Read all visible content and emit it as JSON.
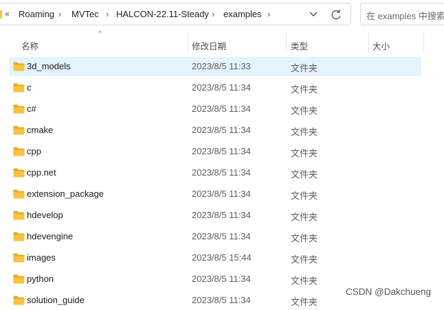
{
  "address_bar": {
    "overflow_label": "«",
    "crumbs": [
      "Roaming",
      "MVTec",
      "HALCON-22.11-Steady",
      "examples"
    ],
    "separator": "›"
  },
  "search": {
    "placeholder": "在 examples 中搜索"
  },
  "columns": {
    "name": "名称",
    "modified": "修改日期",
    "type": "类型",
    "size": "大小"
  },
  "files": [
    {
      "name": "3d_models",
      "modified": "2023/8/5 11:33",
      "type": "文件夹",
      "selected": true
    },
    {
      "name": "c",
      "modified": "2023/8/5 11:34",
      "type": "文件夹"
    },
    {
      "name": "c#",
      "modified": "2023/8/5 11:34",
      "type": "文件夹"
    },
    {
      "name": "cmake",
      "modified": "2023/8/5 11:34",
      "type": "文件夹"
    },
    {
      "name": "cpp",
      "modified": "2023/8/5 11:34",
      "type": "文件夹"
    },
    {
      "name": "cpp.net",
      "modified": "2023/8/5 11:34",
      "type": "文件夹"
    },
    {
      "name": "extension_package",
      "modified": "2023/8/5 11:34",
      "type": "文件夹"
    },
    {
      "name": "hdevelop",
      "modified": "2023/8/5 11:34",
      "type": "文件夹"
    },
    {
      "name": "hdevengine",
      "modified": "2023/8/5 11:34",
      "type": "文件夹"
    },
    {
      "name": "images",
      "modified": "2023/8/5 15:44",
      "type": "文件夹"
    },
    {
      "name": "python",
      "modified": "2023/8/5 11:34",
      "type": "文件夹"
    },
    {
      "name": "solution_guide",
      "modified": "2023/8/5 11:34",
      "type": "文件夹"
    }
  ],
  "watermark": "CSDN @Dakchueng",
  "colors": {
    "selected_row": "#e5f3ff",
    "folder": "#f6c343",
    "folder_dark": "#e8a91f"
  }
}
